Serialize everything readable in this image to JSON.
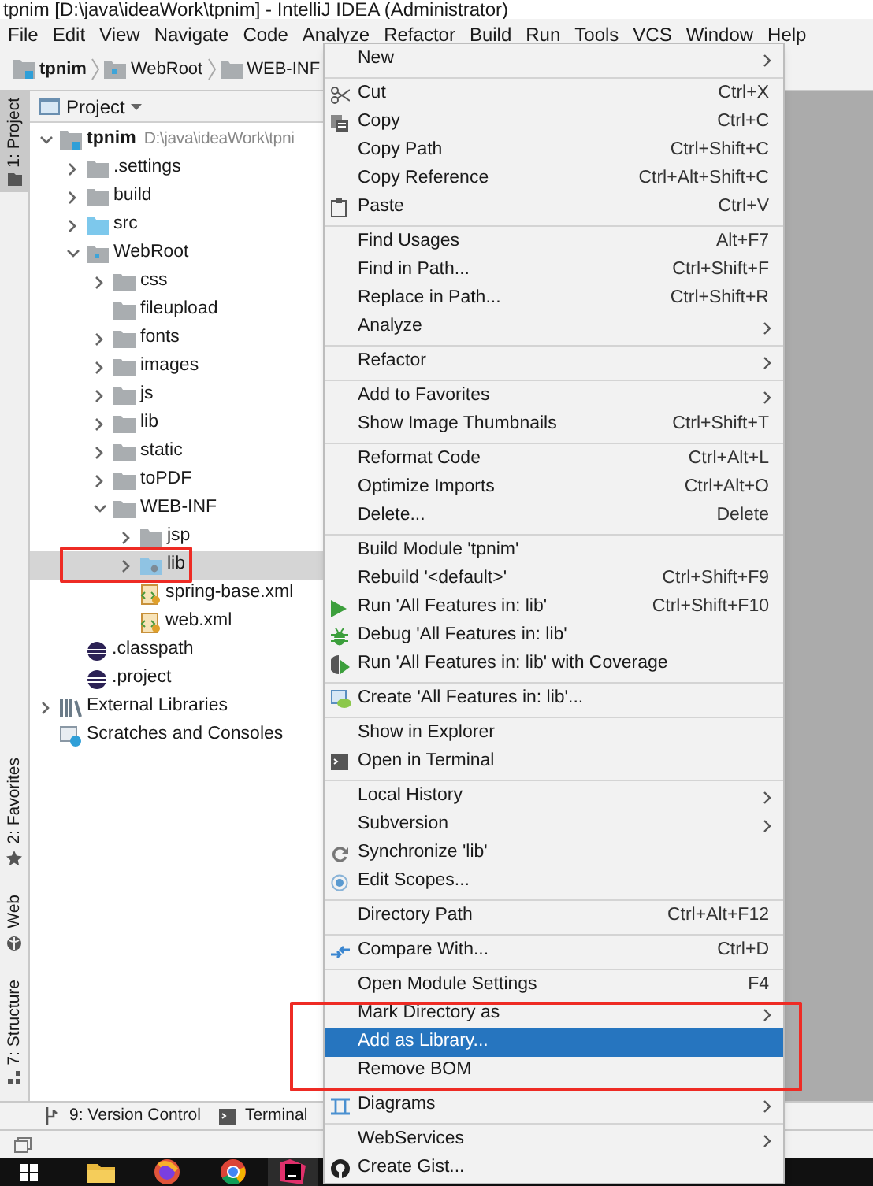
{
  "window": {
    "title": "tpnim [D:\\java\\ideaWork\\tpnim] - IntelliJ IDEA (Administrator)"
  },
  "menu_bar": [
    "File",
    "Edit",
    "View",
    "Navigate",
    "Code",
    "Analyze",
    "Refactor",
    "Build",
    "Run",
    "Tools",
    "VCS",
    "Window",
    "Help"
  ],
  "breadcrumbs": [
    {
      "label": "tpnim",
      "kind": "module"
    },
    {
      "label": "WebRoot",
      "kind": "web_folder"
    },
    {
      "label": "WEB-INF",
      "kind": "folder"
    }
  ],
  "left_tool_tabs": [
    {
      "label": "1: Project",
      "selected": true
    },
    {
      "label": "2: Favorites",
      "selected": false
    },
    {
      "label": "Web",
      "selected": false
    },
    {
      "label": "7: Structure",
      "selected": false
    }
  ],
  "project_panel": {
    "title": "Project",
    "tree": [
      {
        "label": "tpnim",
        "detail": "D:\\java\\ideaWork\\tpni",
        "kind": "module",
        "expanded": true,
        "selected": false,
        "children": [
          {
            "label": ".settings",
            "kind": "folder",
            "expanded": false,
            "selected": false
          },
          {
            "label": "build",
            "kind": "folder",
            "expanded": false,
            "selected": false
          },
          {
            "label": "src",
            "kind": "source_folder",
            "expanded": false,
            "selected": false
          },
          {
            "label": "WebRoot",
            "kind": "web_folder",
            "expanded": true,
            "selected": false,
            "children": [
              {
                "label": "css",
                "kind": "folder",
                "expanded": false,
                "selected": false
              },
              {
                "label": "fileupload",
                "kind": "folder",
                "selected": false
              },
              {
                "label": "fonts",
                "kind": "folder",
                "expanded": false,
                "selected": false
              },
              {
                "label": "images",
                "kind": "folder",
                "expanded": false,
                "selected": false
              },
              {
                "label": "js",
                "kind": "folder",
                "expanded": false,
                "selected": false
              },
              {
                "label": "lib",
                "kind": "folder",
                "expanded": false,
                "selected": false
              },
              {
                "label": "static",
                "kind": "folder",
                "expanded": false,
                "selected": false
              },
              {
                "label": "toPDF",
                "kind": "folder",
                "expanded": false,
                "selected": false
              },
              {
                "label": "WEB-INF",
                "kind": "folder",
                "expanded": true,
                "selected": false,
                "children": [
                  {
                    "label": "jsp",
                    "kind": "folder",
                    "expanded": false,
                    "selected": false
                  },
                  {
                    "label": "lib",
                    "kind": "library_folder",
                    "expanded": false,
                    "selected": true,
                    "circled": true
                  },
                  {
                    "label": "spring-base.xml",
                    "kind": "xml_file",
                    "selected": false
                  },
                  {
                    "label": "web.xml",
                    "kind": "xml_file",
                    "selected": false
                  }
                ]
              }
            ]
          },
          {
            "label": ".classpath",
            "kind": "eclipse_file",
            "selected": false
          },
          {
            "label": ".project",
            "kind": "eclipse_file",
            "selected": false
          }
        ]
      },
      {
        "label": "External Libraries",
        "kind": "external_libraries",
        "expanded": false,
        "selected": false
      },
      {
        "label": "Scratches and Consoles",
        "kind": "scratches",
        "selected": false
      }
    ]
  },
  "bottom_tool_tabs": [
    "9: Version Control",
    "Terminal"
  ],
  "context_menu": {
    "sections": [
      [
        {
          "label": "New",
          "submenu": true,
          "selected": false
        }
      ],
      [
        {
          "label": "Cut",
          "shortcut": "Ctrl+X",
          "selected": false
        },
        {
          "label": "Copy",
          "shortcut": "Ctrl+C",
          "selected": false
        },
        {
          "label": "Copy Path",
          "shortcut": "Ctrl+Shift+C",
          "selected": false
        },
        {
          "label": "Copy Reference",
          "shortcut": "Ctrl+Alt+Shift+C",
          "selected": false
        },
        {
          "label": "Paste",
          "shortcut": "Ctrl+V",
          "selected": false
        }
      ],
      [
        {
          "label": "Find Usages",
          "shortcut": "Alt+F7",
          "selected": false
        },
        {
          "label": "Find in Path...",
          "shortcut": "Ctrl+Shift+F",
          "selected": false
        },
        {
          "label": "Replace in Path...",
          "shortcut": "Ctrl+Shift+R",
          "selected": false
        },
        {
          "label": "Analyze",
          "submenu": true,
          "selected": false
        }
      ],
      [
        {
          "label": "Refactor",
          "submenu": true,
          "selected": false
        }
      ],
      [
        {
          "label": "Add to Favorites",
          "submenu": true,
          "selected": false
        },
        {
          "label": "Show Image Thumbnails",
          "shortcut": "Ctrl+Shift+T",
          "selected": false
        }
      ],
      [
        {
          "label": "Reformat Code",
          "shortcut": "Ctrl+Alt+L",
          "selected": false
        },
        {
          "label": "Optimize Imports",
          "shortcut": "Ctrl+Alt+O",
          "selected": false
        },
        {
          "label": "Delete...",
          "shortcut": "Delete",
          "selected": false
        }
      ],
      [
        {
          "label": "Build Module 'tpnim'",
          "selected": false
        },
        {
          "label": "Rebuild '<default>'",
          "shortcut": "Ctrl+Shift+F9",
          "selected": false
        },
        {
          "label": "Run 'All Features in: lib'",
          "shortcut": "Ctrl+Shift+F10",
          "selected": false
        },
        {
          "label": "Debug 'All Features in: lib'",
          "selected": false
        },
        {
          "label": "Run 'All Features in: lib' with Coverage",
          "selected": false
        }
      ],
      [
        {
          "label": "Create 'All Features in: lib'...",
          "selected": false
        }
      ],
      [
        {
          "label": "Show in Explorer",
          "selected": false
        },
        {
          "label": "Open in Terminal",
          "selected": false
        }
      ],
      [
        {
          "label": "Local History",
          "submenu": true,
          "selected": false
        },
        {
          "label": "Subversion",
          "submenu": true,
          "selected": false
        },
        {
          "label": "Synchronize 'lib'",
          "selected": false
        },
        {
          "label": "Edit Scopes...",
          "selected": false
        }
      ],
      [
        {
          "label": "Directory Path",
          "shortcut": "Ctrl+Alt+F12",
          "selected": false
        }
      ],
      [
        {
          "label": "Compare With...",
          "shortcut": "Ctrl+D",
          "selected": false
        }
      ],
      [
        {
          "label": "Open Module Settings",
          "shortcut": "F4",
          "selected": false
        },
        {
          "label": "Mark Directory as",
          "submenu": true,
          "selected": false,
          "circled": true
        },
        {
          "label": "Add as Library...",
          "selected": true,
          "circled": true
        },
        {
          "label": "Remove BOM",
          "selected": false,
          "circled": true
        }
      ],
      [
        {
          "label": "Diagrams",
          "submenu": true,
          "selected": false
        }
      ],
      [
        {
          "label": "WebServices",
          "submenu": true,
          "selected": false
        },
        {
          "label": "Create Gist...",
          "selected": false
        }
      ]
    ]
  }
}
